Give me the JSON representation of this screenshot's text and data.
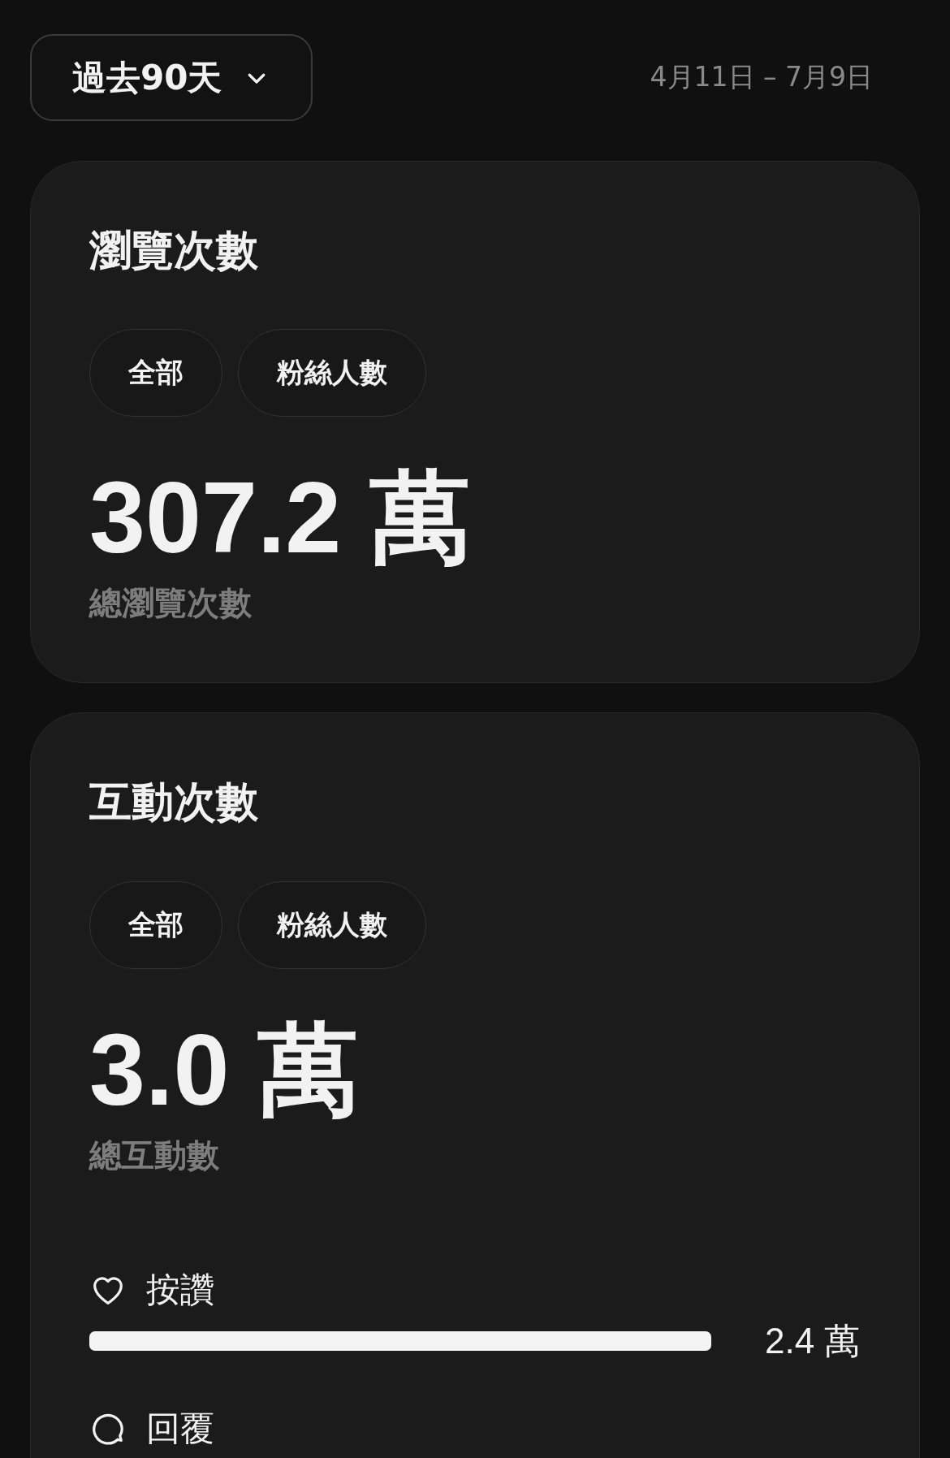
{
  "range_picker": {
    "label": "過去90天"
  },
  "date_range": "4月11日 – 7月9日",
  "cards": [
    {
      "title": "瀏覽次數",
      "filters": [
        "全部",
        "粉絲人數"
      ],
      "total": "307.2 萬",
      "total_label": "總瀏覽次數"
    },
    {
      "title": "互動次數",
      "filters": [
        "全部",
        "粉絲人數"
      ],
      "total": "3.0 萬",
      "total_label": "總互動數",
      "metrics": [
        {
          "kind": "likes",
          "label": "按讚",
          "reading": "2.4 萬"
        },
        {
          "kind": "replies",
          "label": "回覆"
        }
      ]
    }
  ]
}
